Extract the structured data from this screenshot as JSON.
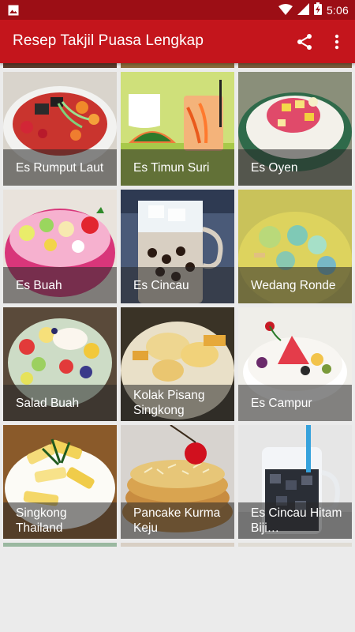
{
  "status_bar": {
    "time": "5:06",
    "icons": [
      "image-notification-icon",
      "wifi-icon",
      "signal-icon",
      "battery-charging-icon"
    ]
  },
  "app_bar": {
    "title": "Resep Takjil Puasa Lengkap",
    "actions": [
      "share-icon",
      "overflow-menu-icon"
    ]
  },
  "colors": {
    "status_bar": "#9c0e15",
    "app_bar": "#c4151c",
    "background": "#ebebeb",
    "caption_overlay": "rgba(40,40,40,0.55)"
  },
  "recipes": [
    {
      "name": "Es Rumput Laut"
    },
    {
      "name": "Es Timun Suri"
    },
    {
      "name": "Es Oyen"
    },
    {
      "name": "Es Buah"
    },
    {
      "name": "Es Cincau"
    },
    {
      "name": "Wedang Ronde"
    },
    {
      "name": "Salad Buah"
    },
    {
      "name": "Kolak Pisang Singkong"
    },
    {
      "name": "Es Campur"
    },
    {
      "name": "Singkong Thailand"
    },
    {
      "name": "Pancake Kurma Keju"
    },
    {
      "name": "Es Cincau Hitam Biji…"
    }
  ]
}
